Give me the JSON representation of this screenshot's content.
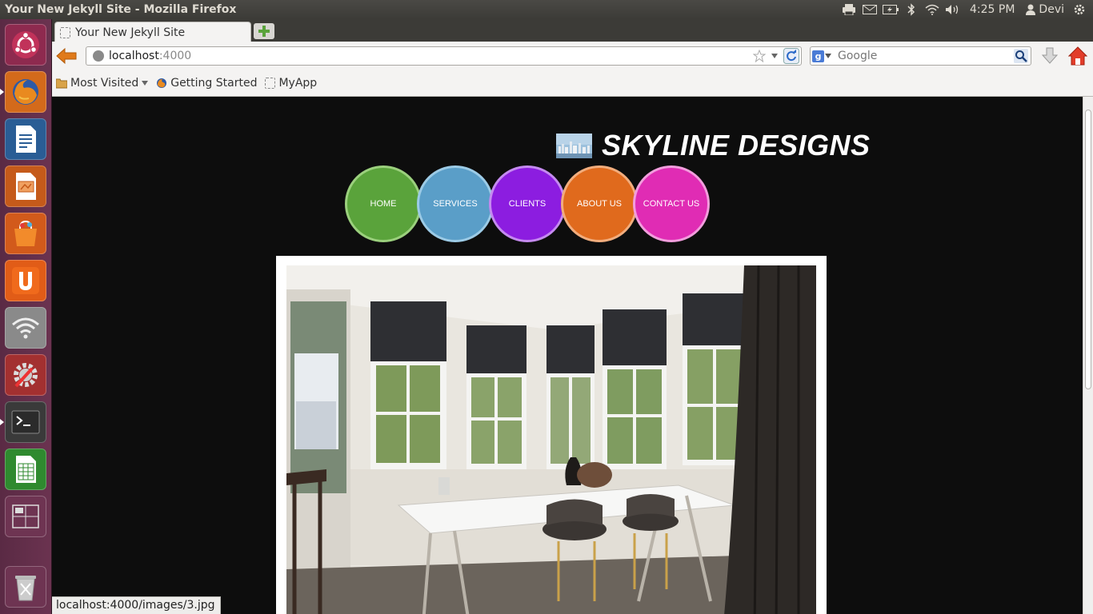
{
  "window": {
    "title": "Your New Jekyll Site - Mozilla Firefox"
  },
  "tray": {
    "time": "4:25 PM",
    "user": "Devi"
  },
  "launcher": {
    "items": [
      "ubuntu-dash",
      "firefox",
      "libreoffice-writer",
      "libreoffice-impress",
      "ubuntu-software-center",
      "ubuntu-one",
      "network",
      "system-settings",
      "terminal",
      "libreoffice-calc",
      "workspace-switcher",
      "trash"
    ]
  },
  "browser": {
    "tab_title": "Your New Jekyll Site",
    "url_host": "localhost",
    "url_port": ":4000",
    "search_placeholder": "Google",
    "bookmarks": [
      {
        "label": "Most Visited"
      },
      {
        "label": "Getting Started"
      },
      {
        "label": "MyApp"
      }
    ],
    "status": "localhost:4000/images/3.jpg"
  },
  "site": {
    "title": "SKYLINE DESIGNS",
    "nav": [
      {
        "label": "HOME",
        "color": "#5aa33b",
        "border": "#9bd07d"
      },
      {
        "label": "SERVICES",
        "color": "#5a9ec8",
        "border": "#9ccbe6"
      },
      {
        "label": "CLIENTS",
        "color": "#8c1de0",
        "border": "#c58af0"
      },
      {
        "label": "ABOUT US",
        "color": "#e06a1d",
        "border": "#f2ad7d"
      },
      {
        "label": "CONTACT US",
        "color": "#e02cb4",
        "border": "#f29ddd"
      }
    ]
  }
}
